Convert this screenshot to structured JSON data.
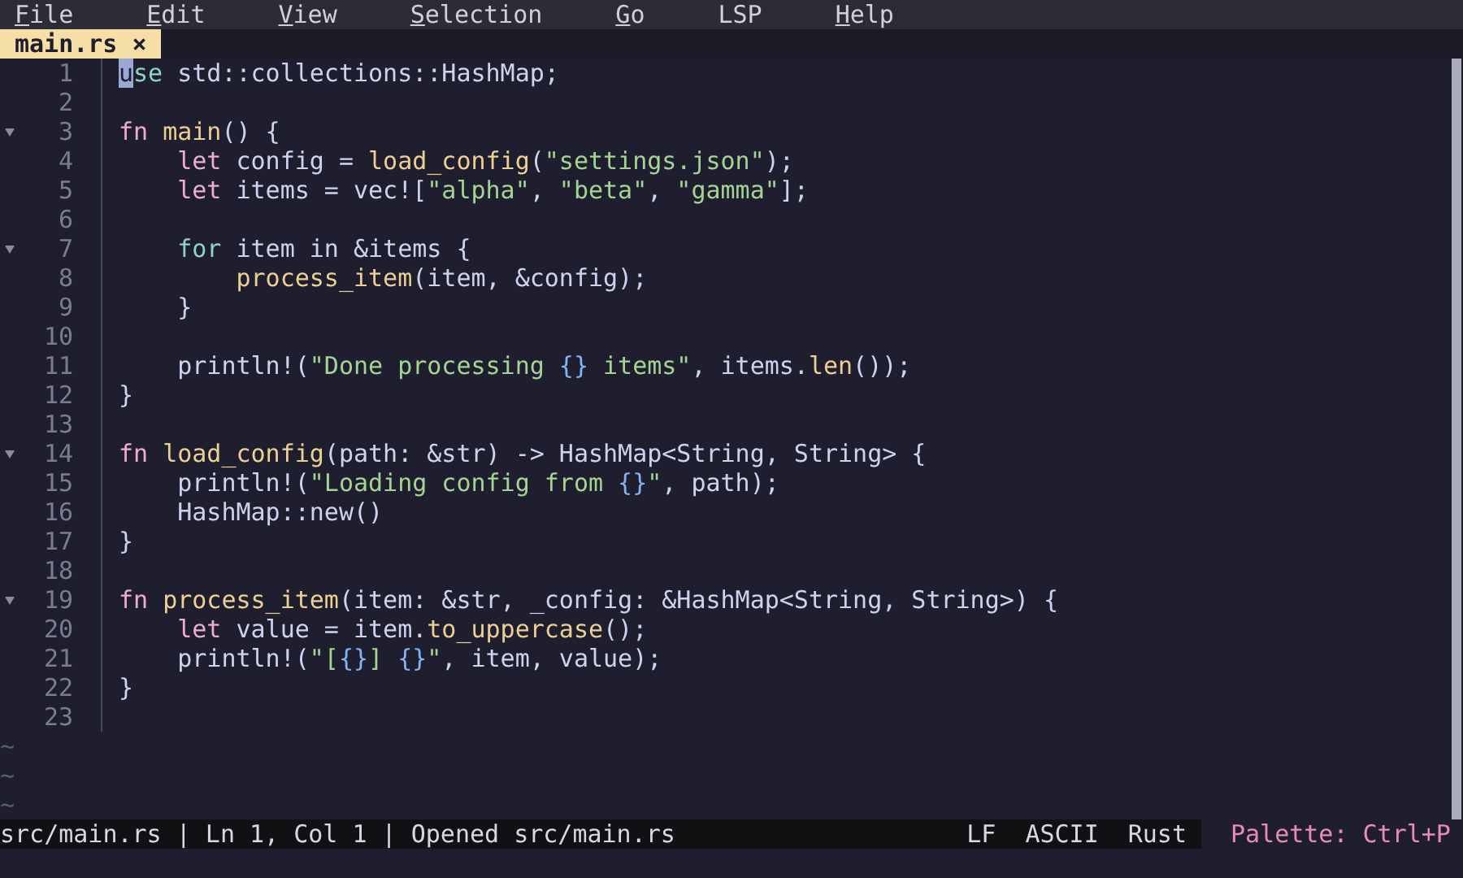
{
  "menu": [
    {
      "label": "File",
      "mnemonic": true
    },
    {
      "label": "Edit",
      "mnemonic": true
    },
    {
      "label": "View",
      "mnemonic": true
    },
    {
      "label": "Selection",
      "mnemonic": true
    },
    {
      "label": "Go",
      "mnemonic": true
    },
    {
      "label": "LSP",
      "mnemonic": false
    },
    {
      "label": "Help",
      "mnemonic": true
    }
  ],
  "tabs": [
    {
      "label": "main.rs",
      "close": "×",
      "selected": true
    }
  ],
  "editor": {
    "lines": [
      {
        "number": "1",
        "kind": "top",
        "foldable": false,
        "tokens": [
          {
            "kind": "cursor",
            "text": "u"
          },
          {
            "kind": "keyword2",
            "text": "se"
          },
          {
            "kind": "plain",
            "text": " std::collections::HashMap;"
          }
        ]
      },
      {
        "number": "2",
        "kind": "top",
        "foldable": false
      },
      {
        "number": "3",
        "kind": "top",
        "foldable": true,
        "tokens": [
          {
            "kind": "keyword",
            "text": "fn "
          },
          {
            "kind": "function",
            "text": "main"
          },
          {
            "kind": "plain",
            "text": "() {"
          }
        ]
      },
      {
        "number": "4",
        "kind": "body",
        "foldable": false,
        "tokens": [
          {
            "kind": "keyword",
            "text": "let"
          },
          {
            "kind": "plain",
            "text": " config = "
          },
          {
            "kind": "function",
            "text": "load_config"
          },
          {
            "kind": "plain",
            "text": "("
          },
          {
            "kind": "string",
            "text": "\"settings.json\""
          },
          {
            "kind": "plain",
            "text": ");"
          }
        ]
      },
      {
        "number": "5",
        "kind": "body",
        "foldable": false,
        "tokens": [
          {
            "kind": "keyword",
            "text": "let"
          },
          {
            "kind": "plain",
            "text": " items = vec!["
          },
          {
            "kind": "string",
            "text": "\"alpha\""
          },
          {
            "kind": "plain",
            "text": ", "
          },
          {
            "kind": "string",
            "text": "\"beta\""
          },
          {
            "kind": "plain",
            "text": ", "
          },
          {
            "kind": "string",
            "text": "\"gamma\""
          },
          {
            "kind": "plain",
            "text": "];"
          }
        ]
      },
      {
        "number": "6",
        "kind": "top",
        "foldable": false
      },
      {
        "number": "7",
        "kind": "body",
        "foldable": true,
        "tokens": [
          {
            "kind": "keyword2",
            "text": "for"
          },
          {
            "kind": "plain",
            "text": " item in &items {"
          }
        ]
      },
      {
        "number": "8",
        "kind": "inner",
        "foldable": false,
        "tokens": [
          {
            "kind": "function",
            "text": "process_item"
          },
          {
            "kind": "plain",
            "text": "(item, &config);"
          }
        ]
      },
      {
        "number": "9",
        "kind": "body",
        "foldable": false,
        "tokens": [
          {
            "kind": "plain",
            "text": "}"
          }
        ]
      },
      {
        "number": "10",
        "kind": "top",
        "foldable": false
      },
      {
        "number": "11",
        "kind": "body",
        "foldable": false,
        "tokens": [
          {
            "kind": "plain",
            "text": "println!("
          },
          {
            "kind": "string",
            "text": "\"Done processing "
          },
          {
            "kind": "interp",
            "text": "{}"
          },
          {
            "kind": "string",
            "text": " items\""
          },
          {
            "kind": "plain",
            "text": ", items."
          },
          {
            "kind": "function",
            "text": "len"
          },
          {
            "kind": "plain",
            "text": "());"
          }
        ]
      },
      {
        "number": "12",
        "kind": "top",
        "foldable": false,
        "tokens": [
          {
            "kind": "plain",
            "text": "}"
          }
        ]
      },
      {
        "number": "13",
        "kind": "top",
        "foldable": false
      },
      {
        "number": "14",
        "kind": "top",
        "foldable": true,
        "tokens": [
          {
            "kind": "keyword",
            "text": "fn "
          },
          {
            "kind": "function",
            "text": "load_config"
          },
          {
            "kind": "plain",
            "text": "(path: &str) -> HashMap<String, String> {"
          }
        ]
      },
      {
        "number": "15",
        "kind": "body",
        "foldable": false,
        "tokens": [
          {
            "kind": "plain",
            "text": "println!("
          },
          {
            "kind": "string",
            "text": "\"Loading config from "
          },
          {
            "kind": "interp",
            "text": "{}"
          },
          {
            "kind": "string",
            "text": "\""
          },
          {
            "kind": "plain",
            "text": ", path);"
          }
        ]
      },
      {
        "number": "16",
        "kind": "body",
        "foldable": false,
        "tokens": [
          {
            "kind": "plain",
            "text": "HashMap::new()"
          }
        ]
      },
      {
        "number": "17",
        "kind": "top",
        "foldable": false,
        "tokens": [
          {
            "kind": "plain",
            "text": "}"
          }
        ]
      },
      {
        "number": "18",
        "kind": "top",
        "foldable": false
      },
      {
        "number": "19",
        "kind": "top",
        "foldable": true,
        "tokens": [
          {
            "kind": "keyword",
            "text": "fn "
          },
          {
            "kind": "function",
            "text": "process_item"
          },
          {
            "kind": "plain",
            "text": "(item: &str, _config: &HashMap<String, String>) {"
          }
        ]
      },
      {
        "number": "20",
        "kind": "body",
        "foldable": false,
        "tokens": [
          {
            "kind": "keyword",
            "text": "let"
          },
          {
            "kind": "plain",
            "text": " value = item."
          },
          {
            "kind": "function",
            "text": "to_uppercase"
          },
          {
            "kind": "plain",
            "text": "();"
          }
        ]
      },
      {
        "number": "21",
        "kind": "body",
        "foldable": false,
        "tokens": [
          {
            "kind": "plain",
            "text": "println!("
          },
          {
            "kind": "string",
            "text": "\"["
          },
          {
            "kind": "interp",
            "text": "{}"
          },
          {
            "kind": "string",
            "text": "] "
          },
          {
            "kind": "interp",
            "text": "{}"
          },
          {
            "kind": "string",
            "text": "\""
          },
          {
            "kind": "plain",
            "text": ", item, value);"
          }
        ]
      },
      {
        "number": "22",
        "kind": "top",
        "foldable": false,
        "tokens": [
          {
            "kind": "plain",
            "text": "}"
          }
        ]
      },
      {
        "number": "23",
        "kind": "top",
        "foldable": false
      }
    ],
    "filler": [
      "~",
      "~",
      "~"
    ]
  },
  "status_bar": {
    "message": "src/main.rs | Ln 1, Col 1 | Opened src/main.rs",
    "line_ending": "LF",
    "encoding": "ASCII",
    "language": "Rust",
    "hint": "Palette: Ctrl+P"
  }
}
